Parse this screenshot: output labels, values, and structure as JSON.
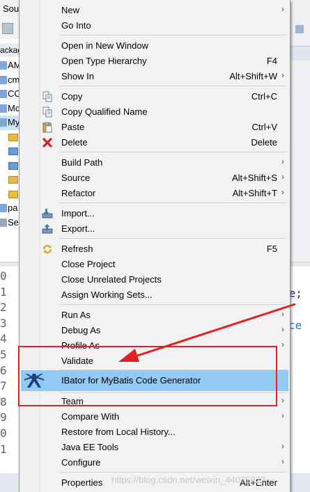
{
  "background": {
    "menubar_fragment": "Sou",
    "explorer_header_fragment": "ackag",
    "tree_fragments": [
      "AM",
      "cm",
      "CC",
      "Mc",
      "My",
      "pa",
      "Se"
    ],
    "line_number_fragments": [
      "0",
      "1",
      "2",
      "3",
      "4",
      "5",
      "6",
      "7",
      "8",
      "9",
      "0",
      "1"
    ],
    "code_fragment_1": "ce;",
    "code_fragment_2": "ce"
  },
  "menu": {
    "items": [
      {
        "label": "New",
        "submenu": true
      },
      {
        "label": "Go Into"
      },
      {
        "label": "Open in New Window"
      },
      {
        "label": "Open Type Hierarchy",
        "shortcut": "F4"
      },
      {
        "label": "Show In",
        "shortcut": "Alt+Shift+W",
        "submenu": true
      },
      {
        "label": "Copy",
        "shortcut": "Ctrl+C",
        "icon": "copy-icon"
      },
      {
        "label": "Copy Qualified Name",
        "icon": "copy-qualified-icon"
      },
      {
        "label": "Paste",
        "shortcut": "Ctrl+V",
        "icon": "paste-icon"
      },
      {
        "label": "Delete",
        "shortcut": "Delete",
        "icon": "delete-icon"
      },
      {
        "label": "Build Path",
        "submenu": true
      },
      {
        "label": "Source",
        "shortcut": "Alt+Shift+S",
        "submenu": true
      },
      {
        "label": "Refactor",
        "shortcut": "Alt+Shift+T",
        "submenu": true
      },
      {
        "label": "Import...",
        "icon": "import-icon"
      },
      {
        "label": "Export...",
        "icon": "export-icon"
      },
      {
        "label": "Refresh",
        "shortcut": "F5",
        "icon": "refresh-icon"
      },
      {
        "label": "Close Project"
      },
      {
        "label": "Close Unrelated Projects"
      },
      {
        "label": "Assign Working Sets..."
      },
      {
        "label": "Run As",
        "submenu": true
      },
      {
        "label": "Debug As",
        "submenu": true
      },
      {
        "label": "Profile As",
        "submenu": true
      },
      {
        "label": "Validate"
      },
      {
        "label": "IBator for MyBatis Code Generator",
        "icon": "ibator-icon",
        "highlighted": true
      },
      {
        "label": "Team",
        "submenu": true
      },
      {
        "label": "Compare With",
        "submenu": true
      },
      {
        "label": "Restore from Local History..."
      },
      {
        "label": "Java EE Tools",
        "submenu": true
      },
      {
        "label": "Configure",
        "submenu": true
      },
      {
        "label": "Properties",
        "shortcut": "Alt+Enter"
      }
    ],
    "submenu_glyph": "›",
    "colors": {
      "highlight": "#91c9f7",
      "annotation_red": "#e22222"
    }
  },
  "watermark": "https://blog.csdn.net/weixin_44075822"
}
